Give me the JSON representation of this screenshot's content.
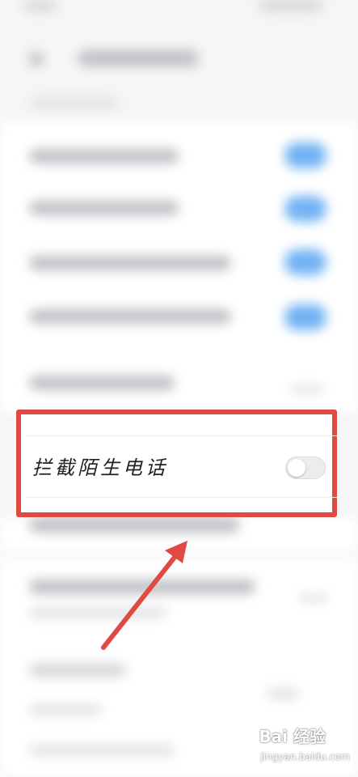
{
  "highlighted_setting": {
    "label": "拦截陌生电话",
    "toggle_state": "off"
  },
  "highlight_color": "#e04a43",
  "arrow_color": "#e04a43",
  "toggle_on_color": "#5aa6f2",
  "watermark": {
    "logo": "Bai 经验",
    "url": "jingyan.baidu.com"
  }
}
